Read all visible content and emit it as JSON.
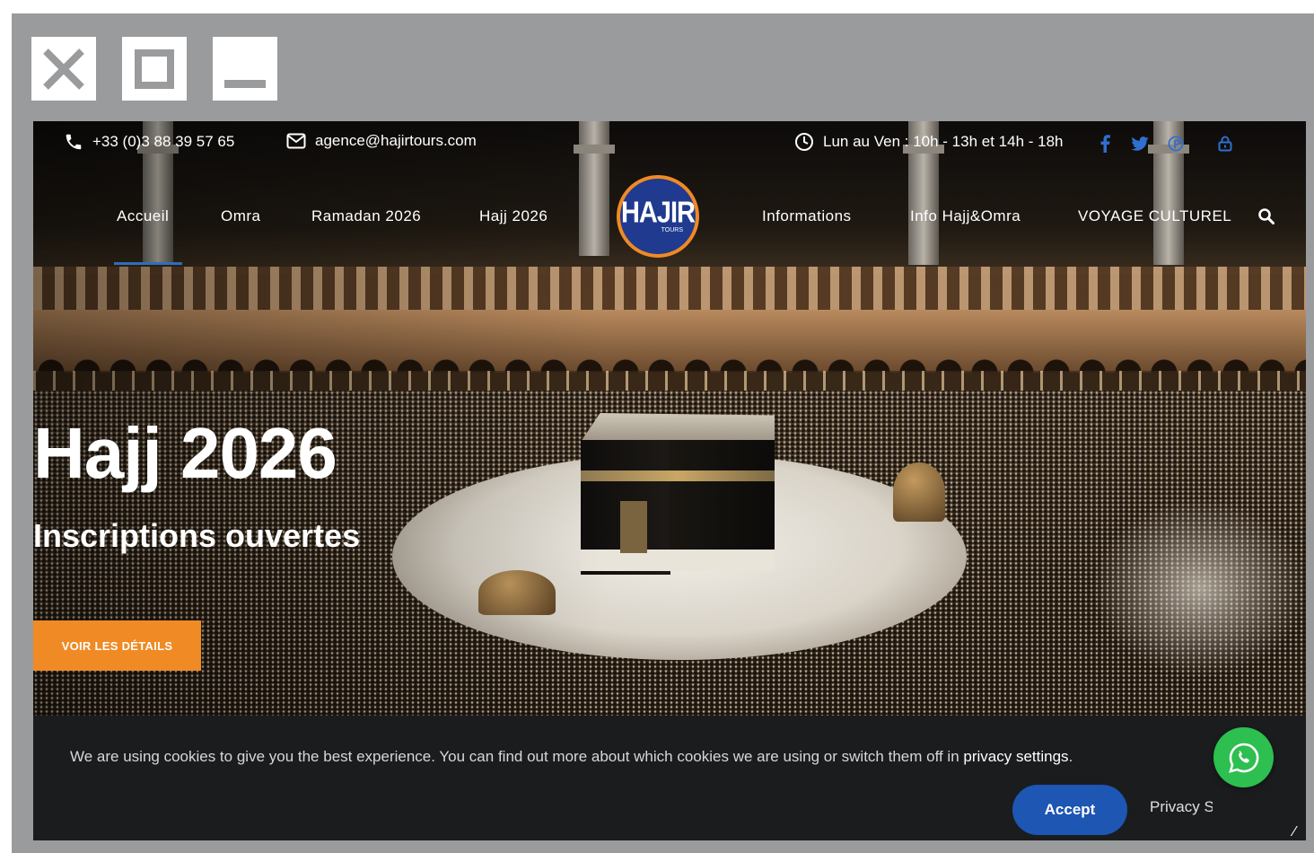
{
  "window": {
    "close_icon": "close-icon",
    "maximize_icon": "maximize-icon",
    "minimize_icon": "minimize-icon"
  },
  "topbar": {
    "phone": "+33 (0)3 88 39 57 65",
    "email": "agence@hajirtours.com",
    "hours": "Lun au Ven : 10h - 13h et 14h - 18h",
    "social_icons": [
      "facebook-icon",
      "twitter-icon",
      "pinterest-icon",
      "lock-icon"
    ]
  },
  "nav": {
    "items": [
      "Accueil",
      "Omra",
      "Ramadan 2026",
      "Hajj 2026",
      "Informations",
      "Info Hajj&Omra",
      "VOYAGE CULTUREL"
    ],
    "active": "Accueil",
    "logo_text": "HAJIR",
    "logo_sub": "TOURS"
  },
  "hero": {
    "title": "Hajj 2026",
    "subtitle": "Inscriptions ouvertes",
    "cta_label": "VOIR LES DÉTAILS"
  },
  "cookie": {
    "text": "We are using cookies to give you the best experience. You can find out more about which cookies we are using or switch them off in ",
    "link": "privacy settings",
    "text_end": ".",
    "accept_label": "Accept",
    "privacy_label": "Privacy Settings",
    "corner_glyph": "⁄"
  },
  "colors": {
    "accent_orange": "#f08a24",
    "accent_blue": "#1d56b3",
    "whatsapp_green": "#2dbf4f",
    "banner_bg": "#1b1c1e"
  }
}
